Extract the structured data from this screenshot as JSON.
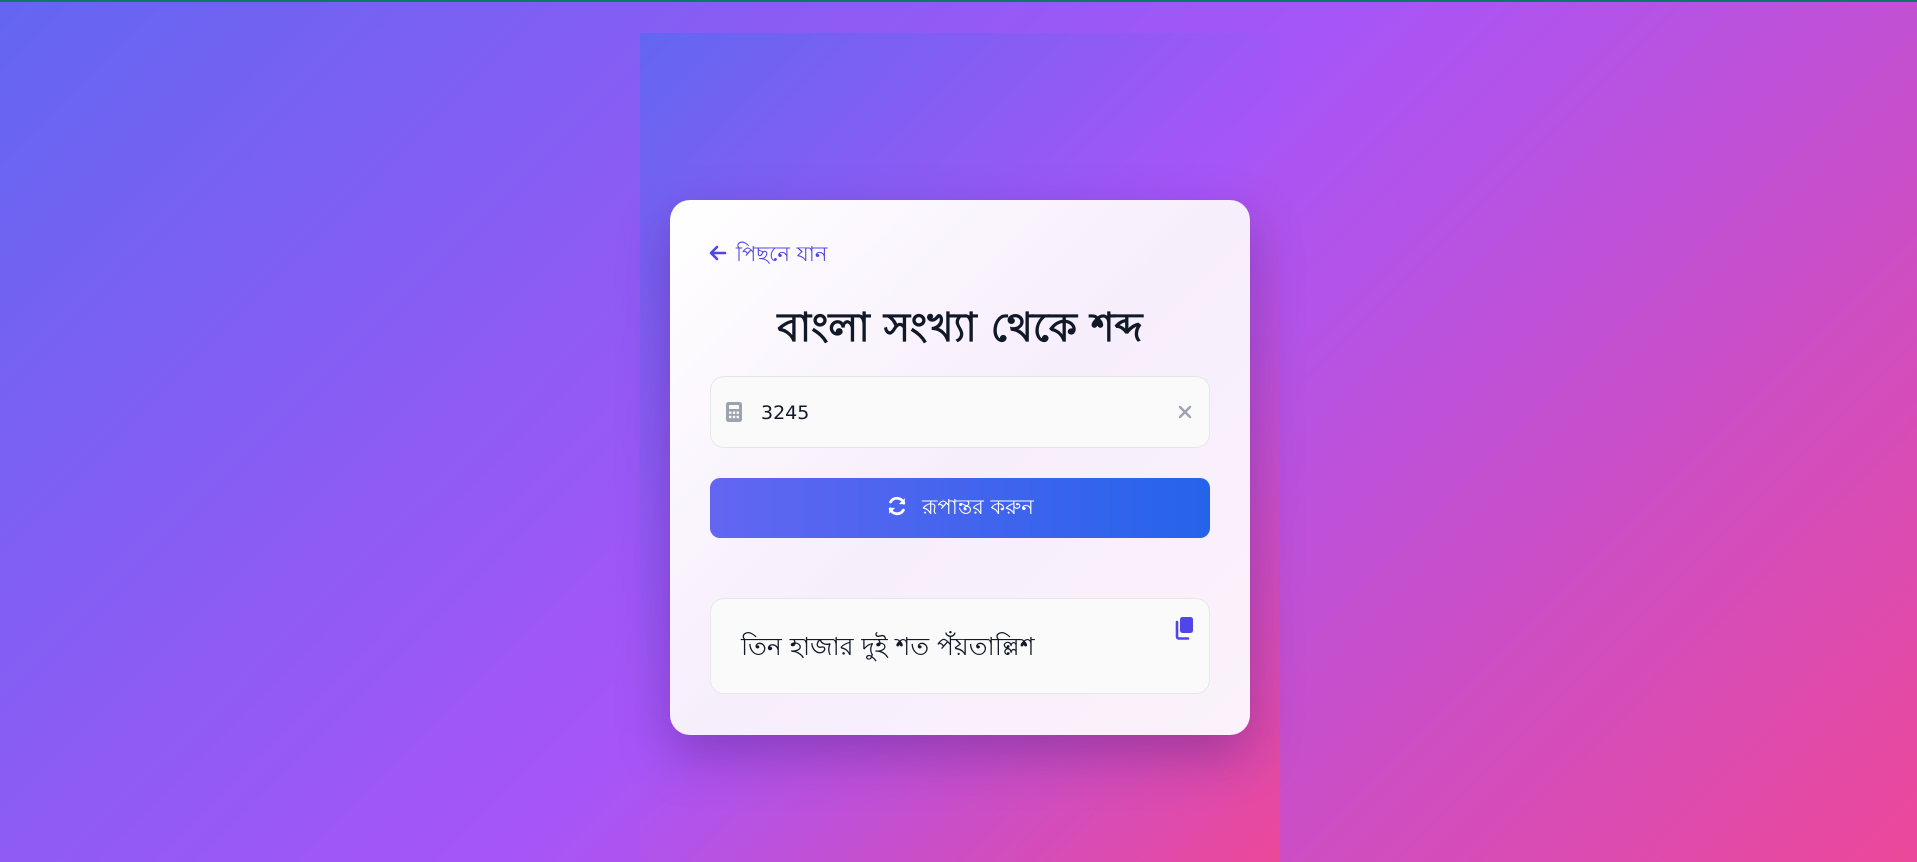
{
  "back": {
    "label": "পিছনে যান",
    "icon": "arrow-left-icon"
  },
  "title": "বাংলা সংখ্যা থেকে শব্দ",
  "input": {
    "value": "3245",
    "icon": "calculator-icon",
    "clear_icon": "close-icon"
  },
  "convert_button": {
    "label": "রূপান্তর করুন",
    "icon": "refresh-icon"
  },
  "result": {
    "text": "তিন হাজার দুই শত পঁয়তাল্লিশ",
    "copy_icon": "copy-icon"
  },
  "colors": {
    "accent": "#4f46e5",
    "button_start": "#6366f1",
    "button_end": "#2563eb",
    "bg_start": "#6366f1",
    "bg_mid": "#a855f7",
    "bg_end": "#ec4899"
  }
}
